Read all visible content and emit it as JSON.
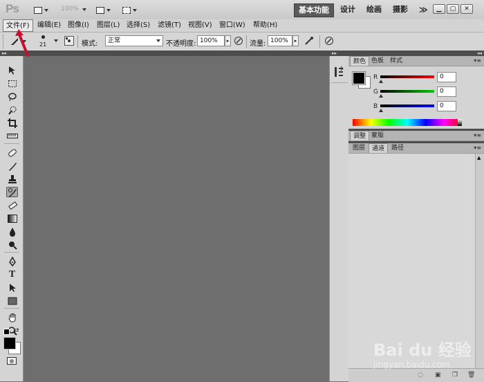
{
  "app": {
    "logo": "Ps",
    "zoom": "100%",
    "workspaces": [
      "基本功能",
      "设计",
      "绘画",
      "摄影",
      "≫"
    ]
  },
  "menubar": {
    "items": [
      "文件(F)",
      "编辑(E)",
      "图像(I)",
      "图层(L)",
      "选择(S)",
      "滤镜(T)",
      "视图(V)",
      "窗口(W)",
      "帮助(H)"
    ]
  },
  "options": {
    "brush_size": "21",
    "mode_label": "模式:",
    "mode_value": "正常",
    "opacity_label": "不透明度:",
    "opacity_value": "100%",
    "flow_label": "流量:",
    "flow_value": "100%"
  },
  "color_panel": {
    "tabs": [
      "颜色",
      "色板",
      "样式"
    ],
    "channels": [
      {
        "name": "R",
        "value": "0",
        "color": "#cc0000"
      },
      {
        "name": "G",
        "value": "0",
        "color": "#00aa00"
      },
      {
        "name": "B",
        "value": "0",
        "color": "#0000cc"
      }
    ]
  },
  "adjust_panel": {
    "tabs": [
      "调整",
      "蒙版"
    ]
  },
  "layers_panel": {
    "tabs": [
      "图层",
      "通道",
      "路径"
    ]
  },
  "watermark": {
    "brand": "Bai du 经验",
    "url": "jingyan.baidu.com"
  },
  "colors": {
    "accent": "#5a5a5a",
    "canvas": "#6e6e6e",
    "panel": "#d4d4d4"
  }
}
